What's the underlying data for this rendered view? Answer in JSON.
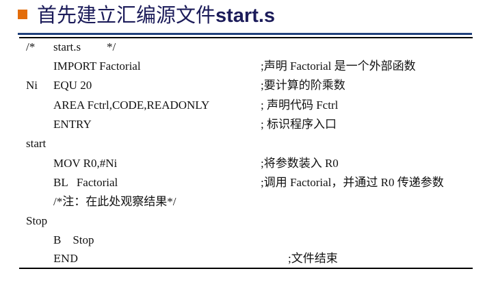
{
  "slide": {
    "bullet_color": "#e36c0a",
    "title_prefix": "首先建立汇编源文件",
    "title_suffix": "start.s"
  },
  "code_lines": [
    {
      "label": "/*",
      "instr": "start.s",
      "extra": "*/",
      "comment": ""
    },
    {
      "label": "",
      "instr": "IMPORT Factorial",
      "extra": "",
      "comment": ";声明 Factorial 是一个外部函数"
    },
    {
      "label": "Ni",
      "instr": "EQU 20",
      "extra": "",
      "comment": ";要计算的阶乘数"
    },
    {
      "label": "",
      "instr": "AREA Fctrl,CODE,READONLY",
      "extra": "",
      "comment": ";  声明代码 Fctrl"
    },
    {
      "label": "",
      "instr": "ENTRY",
      "extra": "",
      "comment": ";  标识程序入口"
    },
    {
      "label": "start",
      "instr": "",
      "extra": "",
      "comment": ""
    },
    {
      "label": "",
      "instr": "MOV R0,#Ni",
      "extra": "",
      "comment": ";将参数装入 R0"
    },
    {
      "label": "",
      "instr": "BL   Factorial",
      "extra": "",
      "comment": ";调用 Factorial，并通过 R0 传递参数"
    },
    {
      "label": "",
      "instr": "/*注：在此处观察结果*/",
      "extra": "",
      "comment": ""
    },
    {
      "label": "Stop",
      "instr": "",
      "extra": "",
      "comment": ""
    },
    {
      "label": "",
      "instr": "B    Stop",
      "extra": "",
      "comment": ""
    },
    {
      "label": "",
      "instr": "END",
      "extra": "",
      "comment": ";文件结束"
    }
  ]
}
